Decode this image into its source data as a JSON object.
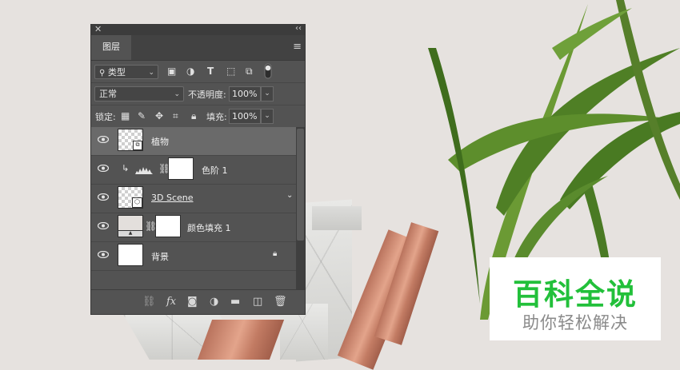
{
  "panel": {
    "tab_label": "图层",
    "filter": {
      "label": "类型",
      "icon": "search-icon"
    },
    "blend_mode": "正常",
    "opacity_label": "不透明度:",
    "opacity_value": "100%",
    "lock_label": "锁定:",
    "fill_label": "填充:",
    "fill_value": "100%"
  },
  "layers": [
    {
      "name": "植物",
      "selected": true,
      "type": "smart-object"
    },
    {
      "name": "色阶 1",
      "selected": false,
      "type": "adjustment-levels"
    },
    {
      "name": "3D Scene",
      "selected": false,
      "type": "3d"
    },
    {
      "name": "颜色填充 1",
      "selected": false,
      "type": "fill"
    },
    {
      "name": "背景",
      "selected": false,
      "type": "background",
      "locked": true
    }
  ],
  "watermark": {
    "main": "百科全说",
    "sub": "助你轻松解决",
    "color": "#22c03a"
  }
}
